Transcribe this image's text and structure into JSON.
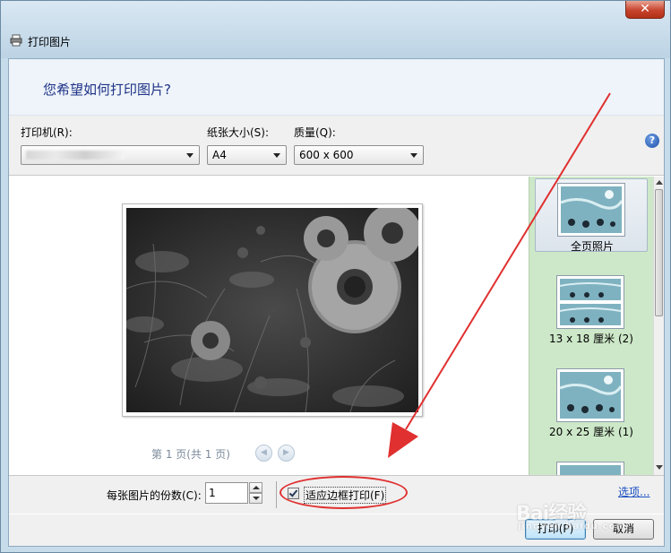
{
  "window": {
    "title": "打印图片",
    "close_label": "✕"
  },
  "header": {
    "question": "您希望如何打印图片?"
  },
  "options": {
    "printer_label": "打印机(R):",
    "paper_label": "纸张大小(S):",
    "paper_value": "A4",
    "quality_label": "质量(Q):",
    "quality_value": "600 x 600",
    "help_label": "?"
  },
  "preview": {
    "page_info": "第 1 页(共 1 页)",
    "prev_label": "◀",
    "next_label": "▶"
  },
  "layouts": [
    {
      "label": "全页照片",
      "selected": true
    },
    {
      "label": "13 x 18 厘米 (2)",
      "selected": false
    },
    {
      "label": "20 x 25 厘米 (1)",
      "selected": false
    },
    {
      "label": "",
      "selected": false
    }
  ],
  "bottom": {
    "copies_label": "每张图片的份数(C):",
    "copies_value": "1",
    "fit_label": "适应边框打印(F)",
    "fit_checked": true,
    "options_link": "选项..."
  },
  "footer": {
    "print_label": "打印(P)",
    "cancel_label": "取消"
  },
  "watermark": {
    "text": "Bai经验",
    "sub": "jingyan.baidu.com"
  },
  "colors": {
    "annotation": "#e03030",
    "layout_panel": "#cde8c8",
    "header_text": "#1e3287"
  }
}
